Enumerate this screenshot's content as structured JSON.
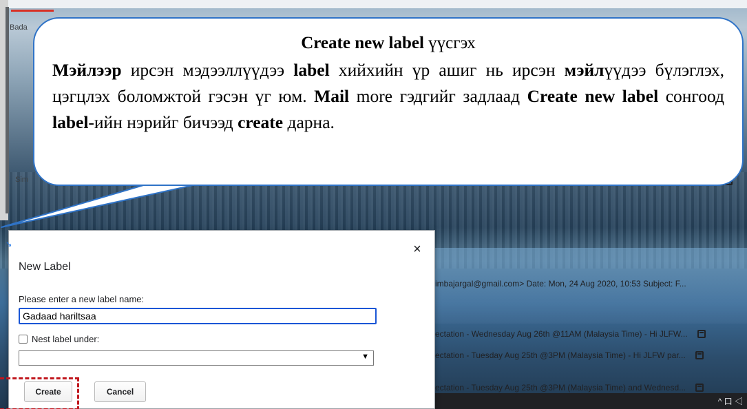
{
  "background": {
    "badge_text": "Bada",
    "sim_text": "Sim",
    "rows": [
      "imbajargal@gmail.com> Date: Mon, 24 Aug 2020, 10:53 Subject: F...",
      "ectation - Wednesday Aug 26th @11AM (Malaysia Time) - Hi JLFW...",
      "ectation - Tuesday Aug 25th @3PM (Malaysia Time) - Hi JLFW par...",
      "ectation - Tuesday Aug 25th @3PM (Malaysia Time) and Wednesd..."
    ],
    "taskbar_icons": "^ 口 ◁"
  },
  "callout": {
    "title_bold": "Create new label",
    "title_rest": " үүсгэх",
    "body_parts": [
      {
        "bold": true,
        "text": "Мэйлээр"
      },
      {
        "bold": false,
        "text": " ирсэн мэдээллүүдээ "
      },
      {
        "bold": true,
        "text": "label"
      },
      {
        "bold": false,
        "text": " хийхийн үр ашиг нь ирсэн "
      },
      {
        "bold": true,
        "text": "мэйл"
      },
      {
        "bold": false,
        "text": "үүдээ  бүлэглэх, цэгцлэх боломжтой гэсэн үг юм. "
      },
      {
        "bold": true,
        "text": "Mail"
      },
      {
        "bold": false,
        "text": " more гэдгийг задлаад "
      },
      {
        "bold": true,
        "text": "Create new label"
      },
      {
        "bold": false,
        "text": " сонгоод "
      },
      {
        "bold": true,
        "text": "label"
      },
      {
        "bold": false,
        "text": "-ийн нэрийг бичээд "
      },
      {
        "bold": true,
        "text": "create"
      },
      {
        "bold": false,
        "text": " дарна."
      }
    ]
  },
  "dialog": {
    "title": "New Label",
    "close_symbol": "×",
    "field_label": "Please enter a new label name:",
    "label_name_value": "Gadaad hariltsaa",
    "nest_label": "Nest label under:",
    "nest_checked": false,
    "nest_selected": "",
    "dropdown_arrow": "▼",
    "create_label": "Create",
    "cancel_label": "Cancel"
  },
  "colors": {
    "callout_border": "#2f73c7",
    "highlight_dash": "#c0161d",
    "input_focus": "#1a56d6"
  }
}
